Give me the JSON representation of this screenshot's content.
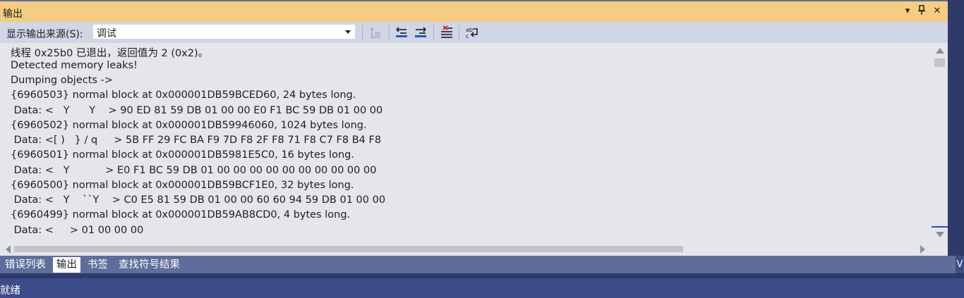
{
  "window": {
    "title": "输出"
  },
  "title_controls": {
    "dropdown": "▾",
    "pin": "⊥",
    "close": "✕"
  },
  "toolbar": {
    "source_label": "显示输出来源(S):",
    "source_value": "调试"
  },
  "output_lines": [
    "线程 0x25b0 已退出，返回值为 2 (0x2)。",
    "Detected memory leaks!",
    "Dumping objects ->",
    "{6960503} normal block at 0x000001DB59BCED60, 24 bytes long.",
    " Data: <   Y      Y    > 90 ED 81 59 DB 01 00 00 E0 F1 BC 59 DB 01 00 00",
    "{6960502} normal block at 0x000001DB59946060, 1024 bytes long.",
    " Data: <[ )   } / q     > 5B FF 29 FC BA F9 7D F8 2F F8 71 F8 C7 F8 B4 F8",
    "{6960501} normal block at 0x000001DB5981E5C0, 16 bytes long.",
    " Data: <   Y           > E0 F1 BC 59 DB 01 00 00 00 00 00 00 00 00 00 00",
    "{6960500} normal block at 0x000001DB59BCF1E0, 32 bytes long.",
    " Data: <   Y    ``Y    > C0 E5 81 59 DB 01 00 00 60 60 94 59 DB 01 00 00",
    "{6960499} normal block at 0x000001DB59AB8CD0, 4 bytes long.",
    " Data: <     > 01 00 00 00"
  ],
  "tabs": [
    {
      "label": "错误列表",
      "active": false
    },
    {
      "label": "输出",
      "active": true
    },
    {
      "label": "书签",
      "active": false
    },
    {
      "label": "查找符号结果",
      "active": false
    }
  ],
  "right_edge_tab": "V",
  "status": {
    "text": "就绪"
  }
}
